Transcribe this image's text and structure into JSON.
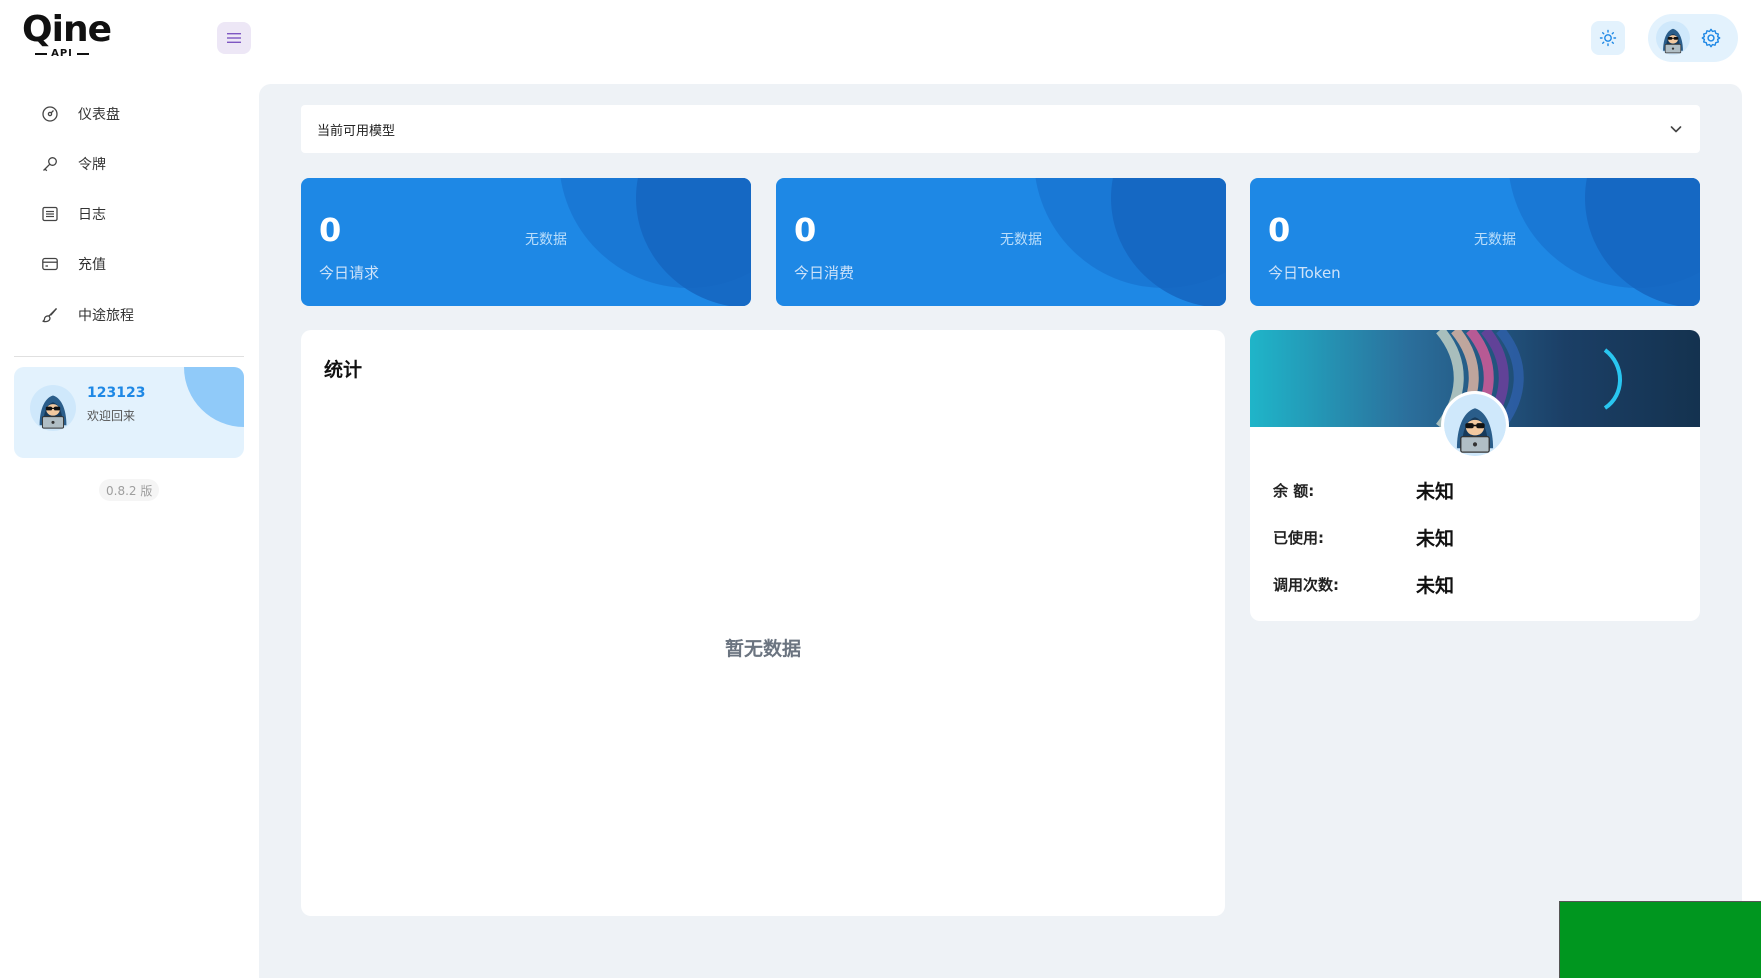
{
  "app": {
    "logo_text": "Qine",
    "logo_sub": "API"
  },
  "header": {
    "menu_icon": "hamburger-icon",
    "theme_icon": "sun-icon",
    "settings_icon": "gear-icon"
  },
  "sidebar": {
    "items": [
      {
        "label": "仪表盘",
        "icon": "dashboard-icon"
      },
      {
        "label": "令牌",
        "icon": "key-icon"
      },
      {
        "label": "日志",
        "icon": "log-icon"
      },
      {
        "label": "充值",
        "icon": "credit-card-icon"
      },
      {
        "label": "中途旅程",
        "icon": "brush-icon"
      }
    ],
    "user": {
      "name": "123123",
      "welcome": "欢迎回来"
    },
    "version": "0.8.2 版"
  },
  "main": {
    "model_select": {
      "label": "当前可用模型"
    },
    "stat_cards": [
      {
        "value": "0",
        "label": "今日请求",
        "no_data": "无数据"
      },
      {
        "value": "0",
        "label": "今日消费",
        "no_data": "无数据"
      },
      {
        "value": "0",
        "label": "今日Token",
        "no_data": "无数据"
      }
    ],
    "stats_panel": {
      "title": "统计",
      "empty": "暂无数据"
    },
    "profile_panel": {
      "rows": [
        {
          "key": "余 额:",
          "value": "未知"
        },
        {
          "key": "已使用:",
          "value": "未知"
        },
        {
          "key": "调用次数:",
          "value": "未知"
        }
      ]
    }
  },
  "colors": {
    "primary": "#1e88e5",
    "accent_light": "#e3f2fd",
    "background": "#eef2f6"
  }
}
